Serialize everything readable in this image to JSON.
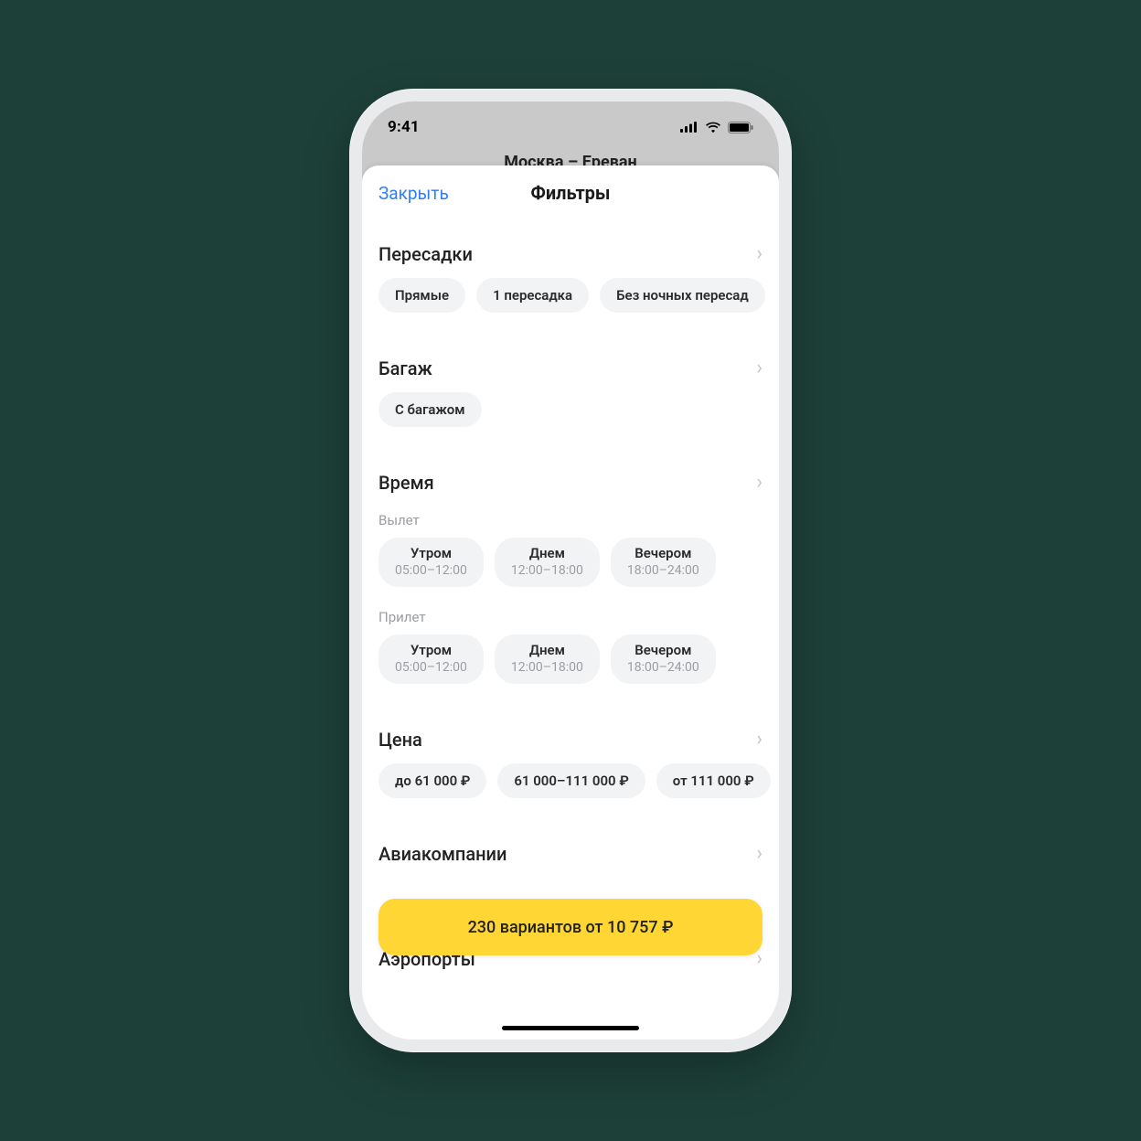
{
  "statusbar": {
    "time": "9:41"
  },
  "background_header": {
    "route": "Москва – Ереван"
  },
  "sheet": {
    "close_label": "Закрыть",
    "title": "Фильтры"
  },
  "sections": {
    "transfers": {
      "title": "Пересадки",
      "chips": [
        "Прямые",
        "1 пересадка",
        "Без ночных пересад"
      ]
    },
    "baggage": {
      "title": "Багаж",
      "chips": [
        "С багажом"
      ]
    },
    "time": {
      "title": "Время",
      "departure_label": "Вылет",
      "arrival_label": "Прилет",
      "slots": [
        {
          "label": "Утром",
          "range": "05:00–12:00"
        },
        {
          "label": "Днем",
          "range": "12:00–18:00"
        },
        {
          "label": "Вечером",
          "range": "18:00–24:00"
        }
      ]
    },
    "price": {
      "title": "Цена",
      "chips": [
        "до 61 000 ₽",
        "61 000–111 000 ₽",
        "от 111 000 ₽"
      ]
    },
    "airlines": {
      "title": "Авиакомпании"
    },
    "airports": {
      "title": "Аэропорты"
    }
  },
  "cta": {
    "label": "230 вариантов от 10 757 ₽"
  }
}
